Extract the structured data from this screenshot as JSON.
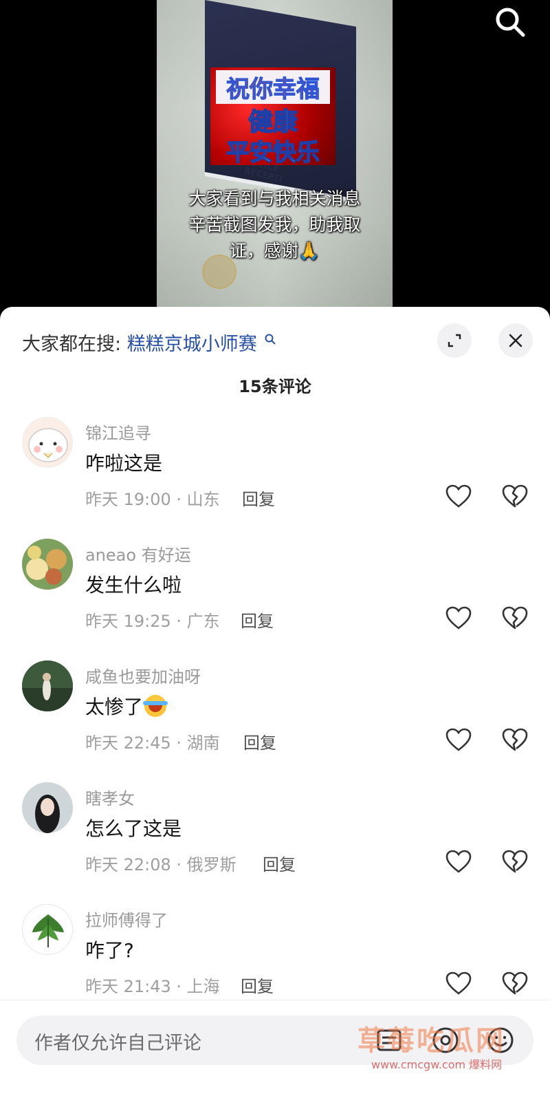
{
  "video": {
    "banner_line1": "祝你幸福",
    "banner_line2": "健康",
    "banner_line3": "平安快乐",
    "sign_text": "POLICE RECEPTI",
    "caption_line1": "大家看到与我相关消息",
    "caption_line2": "辛苦截图发我，助我取",
    "caption_line3": "证，感谢🙏",
    "search_icon": "search-icon"
  },
  "sheet": {
    "trend_lead": "大家都在搜:",
    "trend_link": "糕糕京城小师赛",
    "comment_count": "15条评论",
    "comments": [
      {
        "name": "锦江追寻",
        "text": "咋啦这是",
        "meta": "昨天 19:00 · 山东",
        "reply": "回复"
      },
      {
        "name": "aneao 有好运",
        "text": "发生什么啦",
        "meta": "昨天 19:25 · 广东",
        "reply": "回复"
      },
      {
        "name": "咸鱼也要加油呀",
        "text": "太惨了",
        "meta": "昨天 22:45 · 湖南",
        "reply": "回复"
      },
      {
        "name": "瞎孝女",
        "text": "怎么了这是",
        "meta": "昨天 22:08 · 俄罗斯",
        "reply": "回复"
      },
      {
        "name": "拉师傅得了",
        "text": "咋了?",
        "meta": "昨天 21:43 · 上海",
        "reply": "回复"
      }
    ]
  },
  "bottom": {
    "input_placeholder": "作者仅允许自己评论",
    "watermark": "草莓吃瓜网",
    "watermark_sub": "www.cmcgw.com 爆料网"
  },
  "colors": {
    "link": "#2850a8",
    "meta": "#9f9f9f",
    "banner_red": "#d80000"
  }
}
